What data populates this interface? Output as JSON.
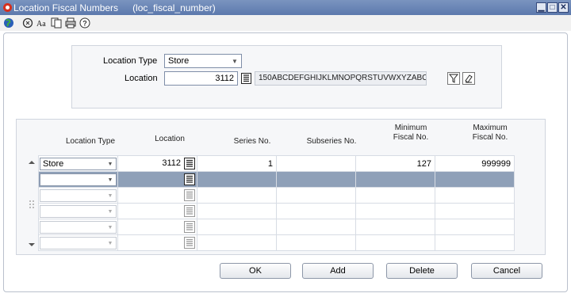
{
  "window": {
    "title": "Location Fiscal Numbers",
    "form_name": "(loc_fiscal_number)",
    "controls": [
      "minimize",
      "maximize",
      "close"
    ]
  },
  "toolbar": {
    "buttons": [
      "globe-icon",
      "spellcheck-icon",
      "font-icon",
      "copy-icon",
      "print-icon",
      "help-icon"
    ]
  },
  "filter": {
    "location_type_label": "Location Type",
    "location_type_value": "Store",
    "location_label": "Location",
    "location_value": "3112",
    "location_name": "150ABCDEFGHIJKLMNOPQRSTUVWXYZABC"
  },
  "grid": {
    "headers": {
      "location_type": "Location Type",
      "location": "Location",
      "series_no": "Series No.",
      "subseries_no": "Subseries No.",
      "minimum_fiscal_no_1": "Minimum",
      "minimum_fiscal_no_2": "Fiscal No.",
      "maximum_fiscal_no_1": "Maximum",
      "maximum_fiscal_no_2": "Fiscal No."
    },
    "rows": [
      {
        "location_type": "Store",
        "location": "3112",
        "series_no": "1",
        "subseries_no": "",
        "min_fiscal": "127",
        "max_fiscal": "999999"
      },
      {
        "location_type": "",
        "location": "",
        "series_no": "",
        "subseries_no": "",
        "min_fiscal": "",
        "max_fiscal": ""
      },
      {
        "location_type": "",
        "location": "",
        "series_no": "",
        "subseries_no": "",
        "min_fiscal": "",
        "max_fiscal": ""
      },
      {
        "location_type": "",
        "location": "",
        "series_no": "",
        "subseries_no": "",
        "min_fiscal": "",
        "max_fiscal": ""
      },
      {
        "location_type": "",
        "location": "",
        "series_no": "",
        "subseries_no": "",
        "min_fiscal": "",
        "max_fiscal": ""
      },
      {
        "location_type": "",
        "location": "",
        "series_no": "",
        "subseries_no": "",
        "min_fiscal": "",
        "max_fiscal": ""
      }
    ],
    "selected_row": 1
  },
  "buttons": {
    "ok": "OK",
    "add": "Add",
    "delete": "Delete",
    "cancel": "Cancel"
  },
  "colors": {
    "titlebar": "#5c79ad",
    "selected_row": "#8fa0b8",
    "close_button": "#d6311f"
  }
}
